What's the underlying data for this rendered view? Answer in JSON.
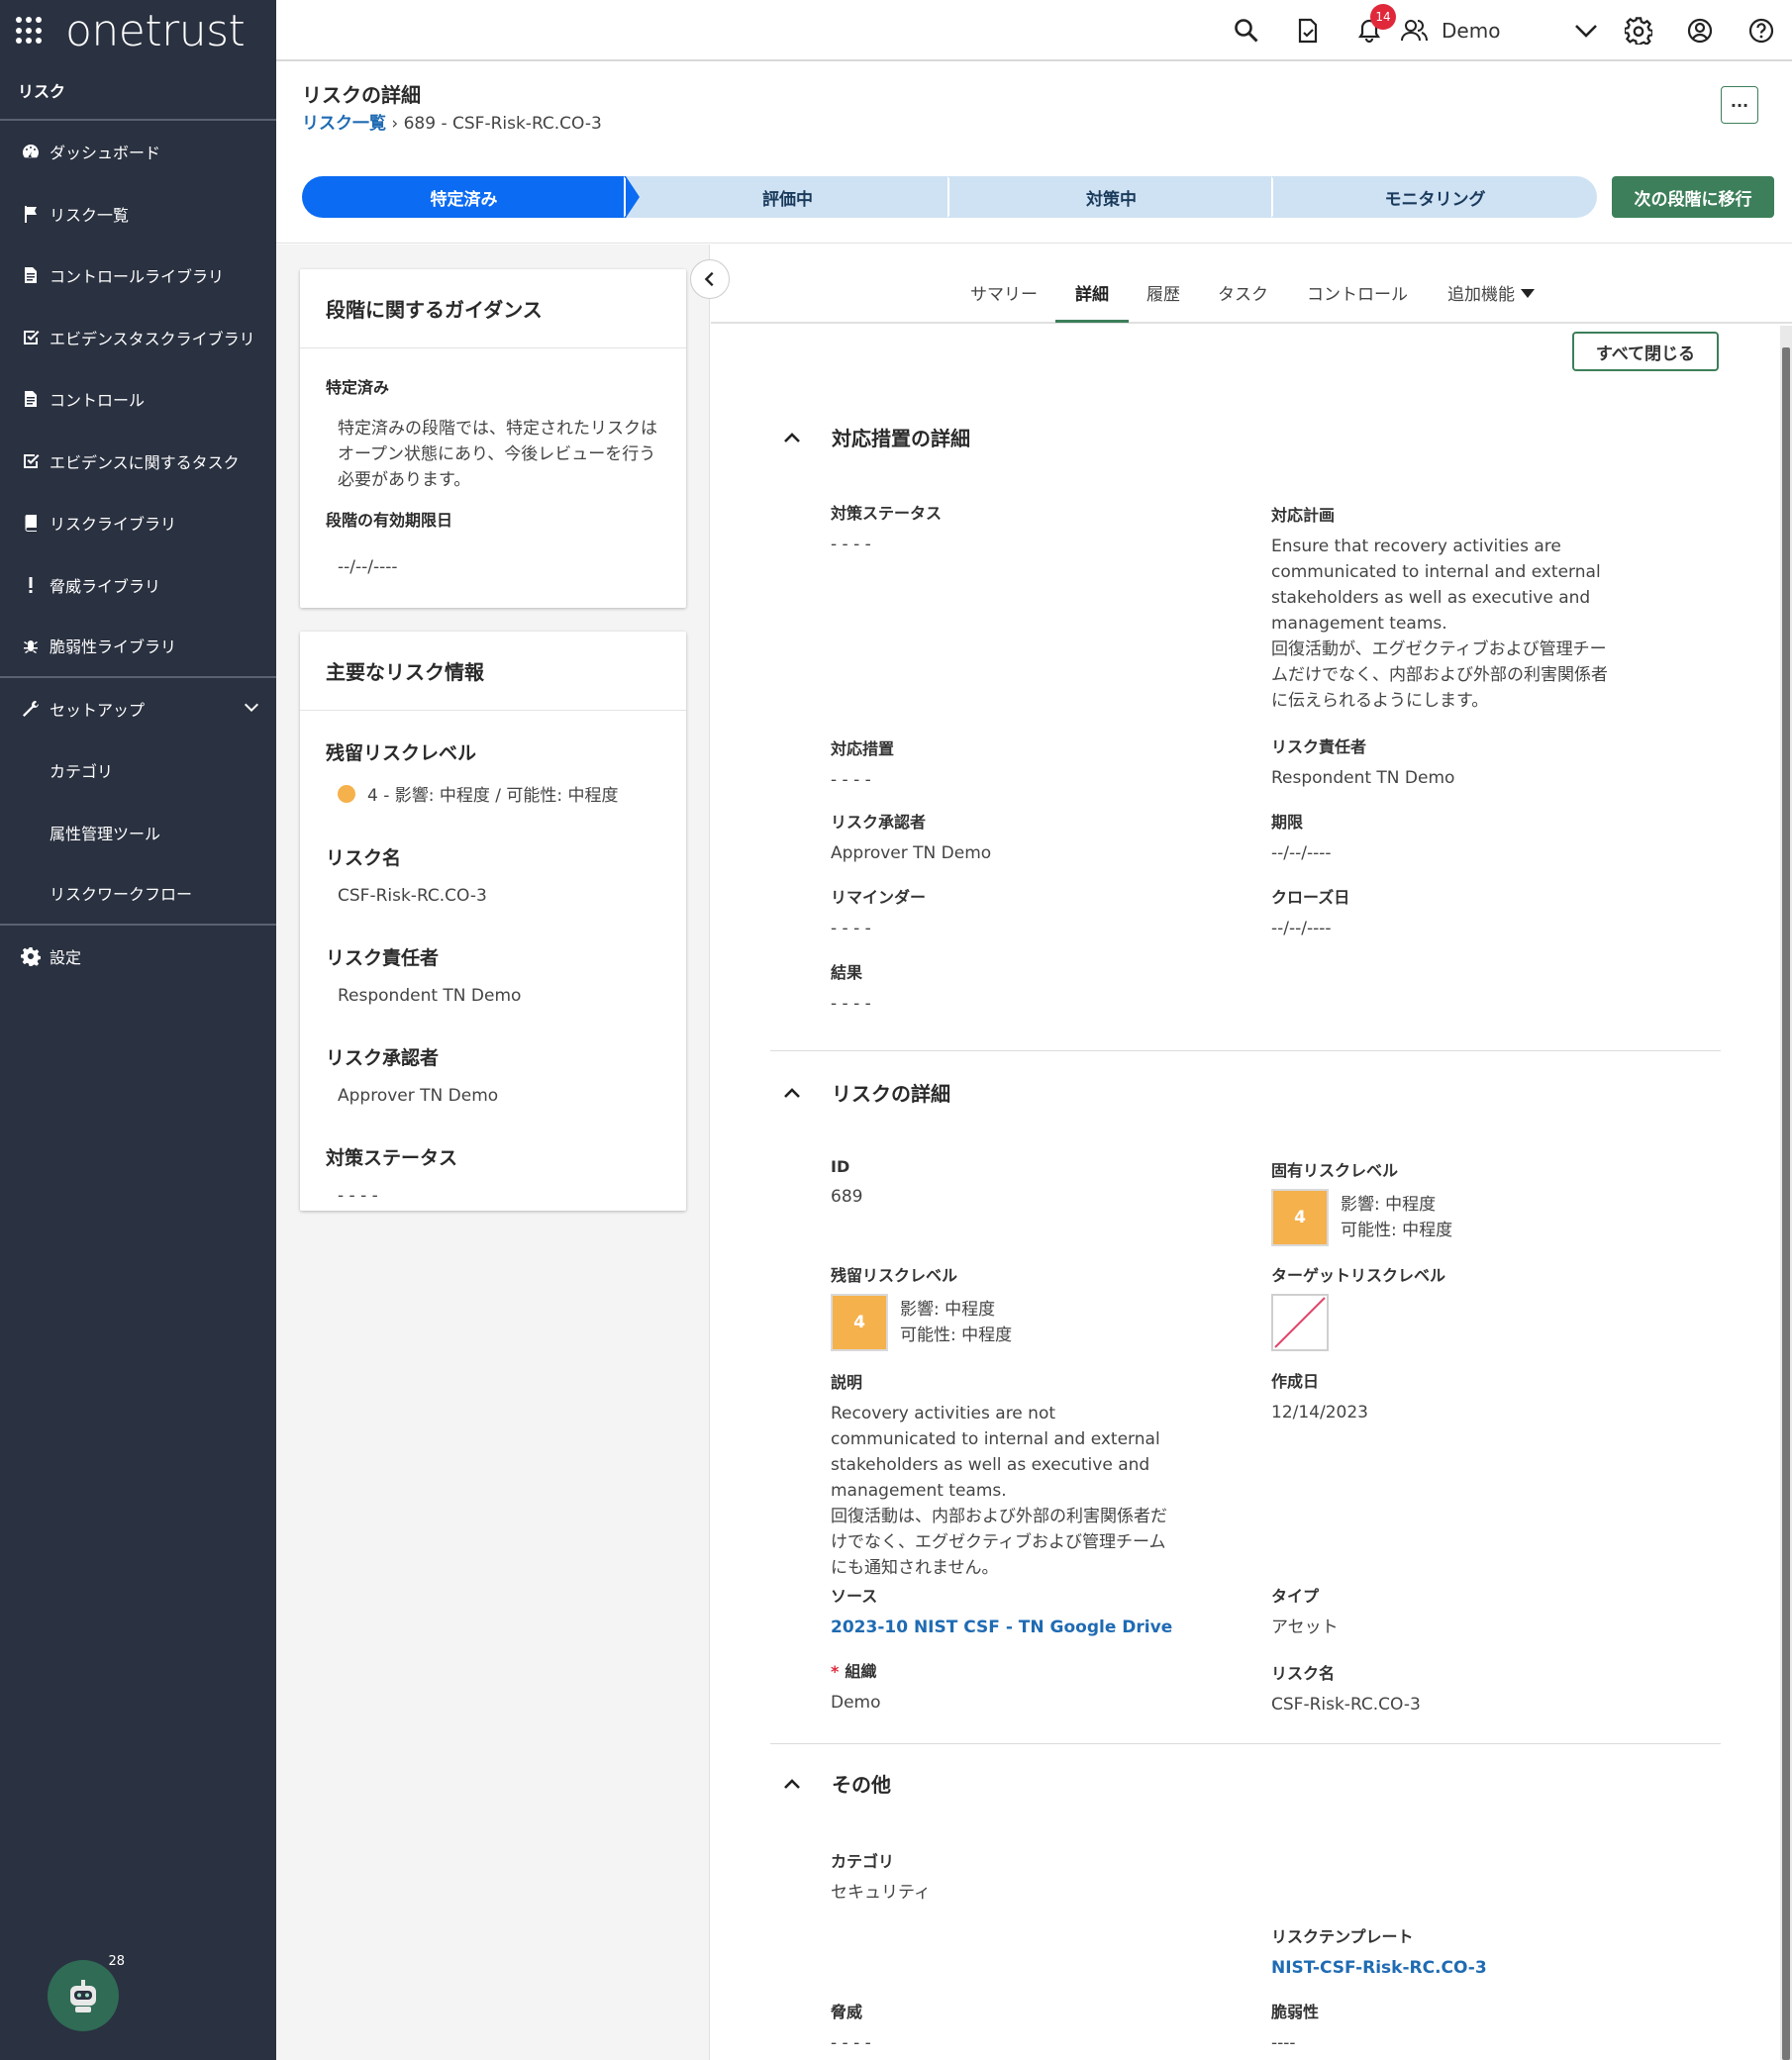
{
  "brand": {
    "name": "onetrust",
    "module": "リスク"
  },
  "sidebar": {
    "items": [
      {
        "label": "ダッシュボード",
        "icon": "dashboard-icon"
      },
      {
        "label": "リスク一覧",
        "icon": "flag-icon"
      },
      {
        "label": "コントロールライブラリ",
        "icon": "document-icon"
      },
      {
        "label": "エビデンスタスクライブラリ",
        "icon": "checkbox-icon"
      },
      {
        "label": "コントロール",
        "icon": "document-icon"
      },
      {
        "label": "エビデンスに関するタスク",
        "icon": "checkbox-icon"
      },
      {
        "label": "リスクライブラリ",
        "icon": "book-icon"
      },
      {
        "label": "脅威ライブラリ",
        "icon": "exclamation-icon"
      },
      {
        "label": "脆弱性ライブラリ",
        "icon": "bug-icon"
      }
    ],
    "setup": {
      "label": "セットアップ",
      "children": [
        "カテゴリ",
        "属性管理ツール",
        "リスクワークフロー"
      ]
    },
    "settings": "設定",
    "bot_badge": "28"
  },
  "topbar": {
    "notifications": "14",
    "user": "Demo"
  },
  "header": {
    "title": "リスクの詳細",
    "breadcrumb_link": "リスク一覧",
    "breadcrumb_current": "689 - CSF-Risk-RC.CO-3",
    "more": "···"
  },
  "stepper": {
    "steps": [
      "特定済み",
      "評価中",
      "対策中",
      "モニタリング"
    ],
    "next_button": "次の段階に移行"
  },
  "guidance": {
    "title": "段階に関するガイダンス",
    "stage_label": "特定済み",
    "stage_text": "特定済みの段階では、特定されたリスクはオープン状態にあり、今後レビューを行う必要があります。",
    "deadline_label": "段階の有効期限日",
    "deadline_value": "--/--/----"
  },
  "key_info": {
    "title": "主要なリスク情報",
    "residual_label": "残留リスクレベル",
    "residual_value": "4 - 影響: 中程度 / 可能性: 中程度",
    "name_label": "リスク名",
    "name_value": "CSF-Risk-RC.CO-3",
    "owner_label": "リスク責任者",
    "owner_value": "Respondent TN Demo",
    "approver_label": "リスク承認者",
    "approver_value": "Approver TN Demo",
    "status_label": "対策ステータス",
    "status_value": "- - - -"
  },
  "tabs": [
    "サマリー",
    "詳細",
    "履歴",
    "タスク",
    "コントロール",
    "追加機能"
  ],
  "close_all": "すべて閉じる",
  "treatment": {
    "title": "対応措置の詳細",
    "status_label": "対策ステータス",
    "status_value": "- - - -",
    "plan_label": "対応計画",
    "plan_value": "Ensure that recovery activities are communicated to internal and external stakeholders as well as executive and management teams.",
    "plan_value_ja": "回復活動が、エグゼクティブおよび管理チームだけでなく、内部および外部の利害関係者に伝えられるようにします。",
    "action_label": "対応措置",
    "action_value": "- - - -",
    "owner_label": "リスク責任者",
    "owner_value": "Respondent TN Demo",
    "approver_label": "リスク承認者",
    "approver_value": "Approver TN Demo",
    "deadline_label": "期限",
    "deadline_value": "--/--/----",
    "reminder_label": "リマインダー",
    "reminder_value": "- - - -",
    "close_label": "クローズ日",
    "close_value": "--/--/----",
    "result_label": "結果",
    "result_value": "- - - -"
  },
  "risk": {
    "title": "リスクの詳細",
    "id_label": "ID",
    "id_value": "689",
    "inherent_label": "固有リスクレベル",
    "inherent_score": "4",
    "inherent_impact": "影響: 中程度",
    "inherent_likelihood": "可能性: 中程度",
    "residual_label": "残留リスクレベル",
    "residual_score": "4",
    "residual_impact": "影響: 中程度",
    "residual_likelihood": "可能性: 中程度",
    "target_label": "ターゲットリスクレベル",
    "desc_label": "説明",
    "desc_value": "Recovery activities are not communicated to internal and external stakeholders as well as executive and management teams.",
    "desc_value_ja": "回復活動は、内部および外部の利害関係者だけでなく、エグゼクティブおよび管理チームにも通知されません。",
    "created_label": "作成日",
    "created_value": "12/14/2023",
    "source_label": "ソース",
    "source_value": "2023-10 NIST CSF - TN Google Drive",
    "type_label": "タイプ",
    "type_value": "アセット",
    "org_label": "組織",
    "org_value": "Demo",
    "name_label": "リスク名",
    "name_value": "CSF-Risk-RC.CO-3"
  },
  "other": {
    "title": "その他",
    "category_label": "カテゴリ",
    "category_value": "セキュリティ",
    "template_label": "リスクテンプレート",
    "template_value": "NIST-CSF-Risk-RC.CO-3",
    "threat_label": "脅威",
    "threat_value": "- - - -",
    "vuln_label": "脆弱性",
    "vuln_value": "----"
  },
  "colors": {
    "sidebar": "#2a3140",
    "accent": "#3d7f5a",
    "active_step": "#0b6bf2",
    "risk_medium": "#f5b14c",
    "link": "#1f6bb3"
  }
}
